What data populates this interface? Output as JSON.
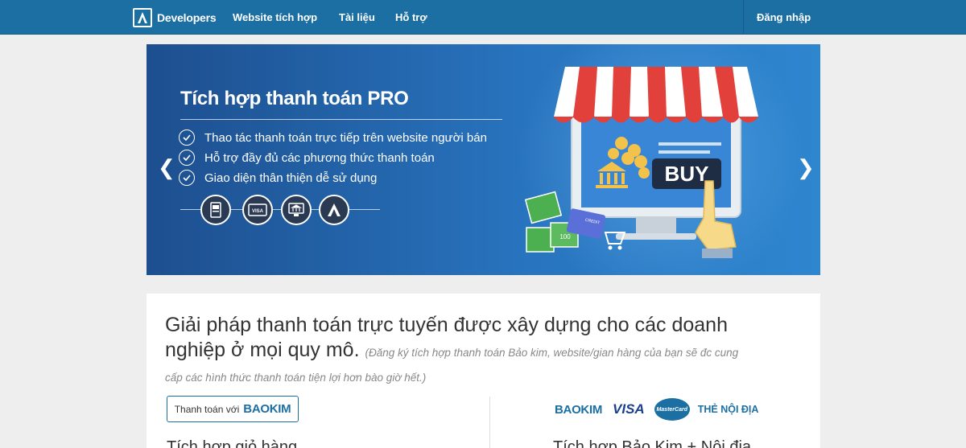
{
  "nav": {
    "brand": "Developers",
    "links": [
      "Website tích hợp",
      "Tài liệu",
      "Hỗ trợ"
    ],
    "login": "Đăng nhập"
  },
  "banner": {
    "title": "Tích hợp thanh toán PRO",
    "features": [
      "Thao tác thanh toán trực tiếp trên website người bán",
      "Hỗ trợ đầy đủ các phương thức thanh toán",
      "Giao diện thân thiện dễ sử dụng"
    ],
    "prev_arrow": "❮",
    "next_arrow": "❯",
    "buy_label": "BUY",
    "card_label": "CREDIT",
    "cash_value": "100",
    "visa_label": "VISA"
  },
  "content": {
    "headline": "Giải pháp thanh toán trực tuyến được xây dựng cho các doanh nghiệp ở mọi quy mô.",
    "subtext": "(Đăng ký tích hợp thanh toán Bảo kim, website/gian hàng của bạn sẽ đc cung cấp các hình thức thanh toán tiện lợi hơn bào giờ hết.)",
    "pay_button_prefix": "Thanh toán với",
    "pay_button_brand": "BAOKIM",
    "logos": {
      "baokim": "BAOKIM",
      "visa": "VISA",
      "mastercard": "MasterCard",
      "noidia": "THẺ NỘI ĐỊA"
    },
    "left_heading": "Tích hợp giỏ hàng",
    "right_heading": "Tích hợp Bảo Kim + Nội địa"
  },
  "colors": {
    "nav_bg": "#1c6fa3",
    "banner_dark": "#1d4f8f",
    "banner_light": "#2e86cf",
    "page_bg": "#eeeeee",
    "accent": "#1c6fa3"
  }
}
